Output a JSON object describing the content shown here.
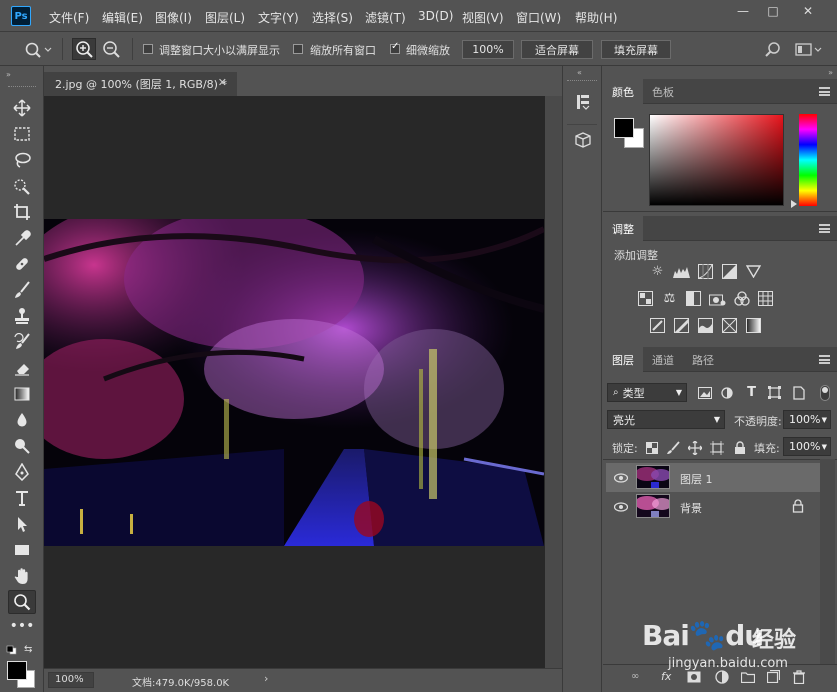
{
  "app": {
    "logo": "Ps",
    "menus": [
      "文件(F)",
      "编辑(E)",
      "图像(I)",
      "图层(L)",
      "文字(Y)",
      "选择(S)",
      "滤镜(T)",
      "3D(D)",
      "视图(V)",
      "窗口(W)",
      "帮助(H)"
    ],
    "window_controls": [
      "—",
      "□",
      "✕"
    ]
  },
  "options": {
    "resize_windows": "调整窗口大小以满屏显示",
    "zoom_all_windows": "缩放所有窗口",
    "scrubby_zoom": "细微缩放",
    "zoom_value": "100%",
    "fit_screen": "适合屏幕",
    "fill_screen": "填充屏幕",
    "resize_checked": false,
    "zoom_all_checked": false,
    "scrubby_checked": true
  },
  "document": {
    "tab_title": "2.jpg @ 100% (图层 1, RGB/8) *",
    "zoom": "100%",
    "doc_info": "文档:479.0K/958.0K"
  },
  "color_panel": {
    "tabs": [
      "颜色",
      "色板"
    ],
    "foreground": "#000000",
    "background": "#ffffff",
    "hue_color": "#e8141c"
  },
  "adjust_panel": {
    "tab": "调整",
    "add_label": "添加调整"
  },
  "layers_panel": {
    "tabs": [
      "图层",
      "通道",
      "路径"
    ],
    "filter_kind": "类型",
    "blend_mode": "亮光",
    "opacity_label": "不透明度:",
    "opacity_value": "100%",
    "lock_label": "锁定:",
    "fill_label": "填充:",
    "fill_value": "100%",
    "layers": [
      {
        "name": "图层 1",
        "selected": true,
        "locked": false
      },
      {
        "name": "背景",
        "selected": false,
        "locked": true
      }
    ]
  },
  "watermark": {
    "brand": "Bai",
    "brand2": "du",
    "suffix": "经验",
    "url": "jingyan.baidu.com"
  }
}
